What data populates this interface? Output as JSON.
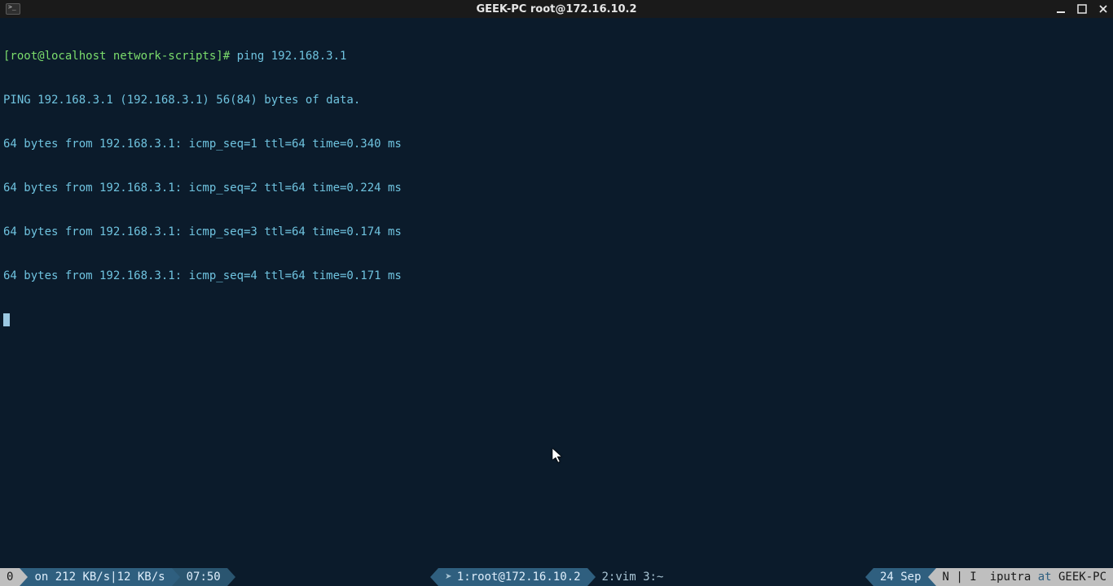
{
  "titlebar": {
    "title": "GEEK-PC root@172.16.10.2"
  },
  "terminal": {
    "prompt": "[root@localhost network-scripts]#",
    "command": " ping 192.168.3.1",
    "lines": [
      "PING 192.168.3.1 (192.168.3.1) 56(84) bytes of data.",
      "64 bytes from 192.168.3.1: icmp_seq=1 ttl=64 time=0.340 ms",
      "64 bytes from 192.168.3.1: icmp_seq=2 ttl=64 time=0.224 ms",
      "64 bytes from 192.168.3.1: icmp_seq=3 ttl=64 time=0.174 ms",
      "64 bytes from 192.168.3.1: icmp_seq=4 ttl=64 time=0.171 ms"
    ]
  },
  "status": {
    "session": "0",
    "net": "on 212 KB/s|12 KB/s",
    "time": "07:50",
    "active_window": "1:root@172.16.10.2",
    "windows_rest": "2:vim  3:~",
    "date": "24 Sep",
    "mode": "N | I",
    "user": "iputra",
    "at": "at",
    "host": "GEEK-PC"
  }
}
